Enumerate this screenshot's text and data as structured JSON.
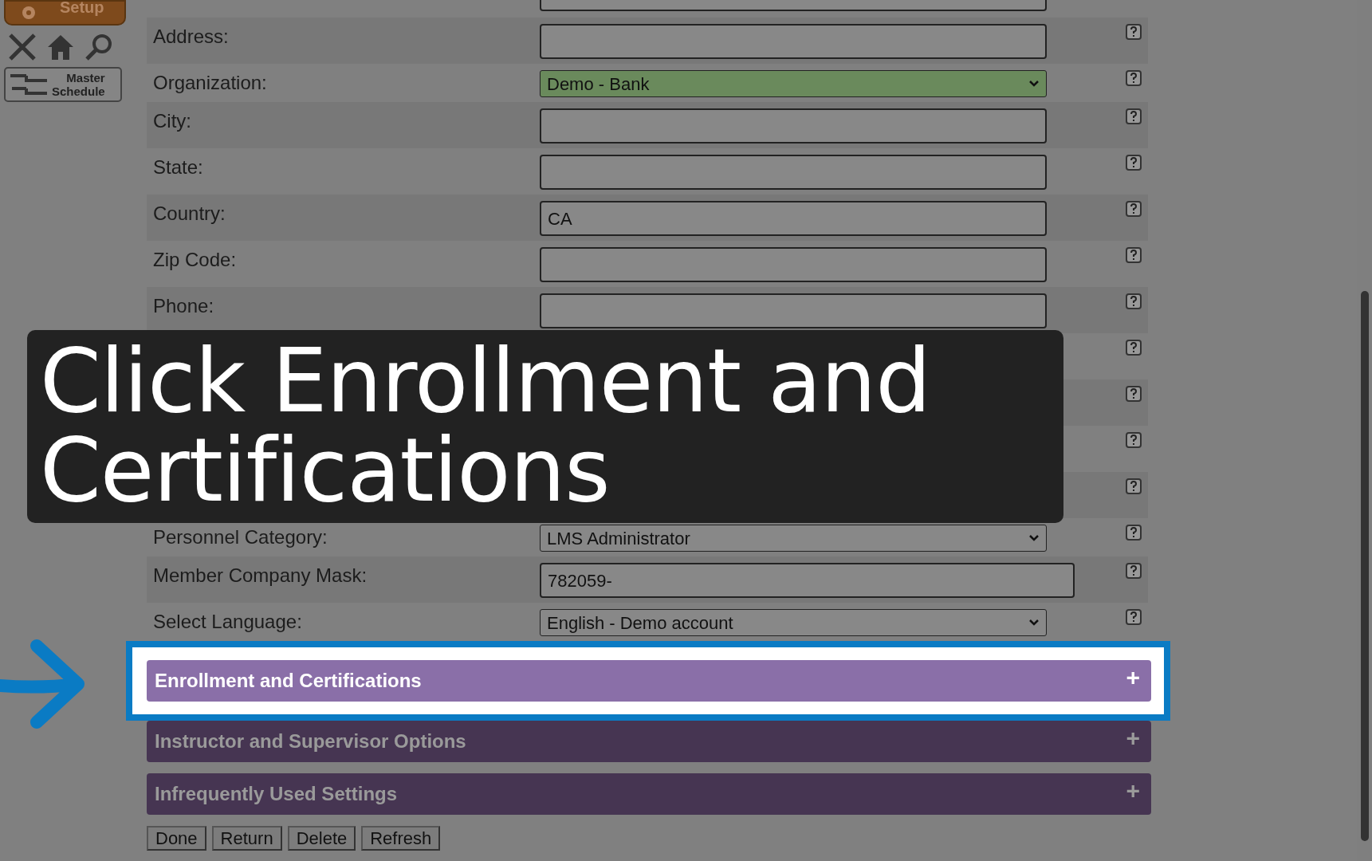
{
  "sidebar": {
    "setup_button": "Setup",
    "schedule_button": [
      "Master",
      "Schedule"
    ]
  },
  "form": {
    "rows": [
      {
        "kind": "input",
        "label": "Address:",
        "value": ""
      },
      {
        "kind": "select",
        "label": "Organization:",
        "value": "Demo - Bank",
        "highlighted": true
      },
      {
        "kind": "input",
        "label": "City:",
        "value": ""
      },
      {
        "kind": "input",
        "label": "State:",
        "value": ""
      },
      {
        "kind": "input",
        "label": "Country:",
        "value": "CA"
      },
      {
        "kind": "input",
        "label": "Zip Code:",
        "value": ""
      },
      {
        "kind": "input",
        "label": "Phone:",
        "value": ""
      },
      {
        "kind": "covered"
      },
      {
        "kind": "covered"
      },
      {
        "kind": "covered"
      },
      {
        "kind": "covered"
      },
      {
        "kind": "select",
        "label": "Personnel Category:",
        "value": "LMS Administrator",
        "highlighted": false
      },
      {
        "kind": "wide",
        "label": "Member Company Mask:",
        "value": "782059-"
      },
      {
        "kind": "select",
        "label": "Select Language:",
        "value": "English - Demo account",
        "highlighted": false
      }
    ]
  },
  "sections": [
    {
      "title": "Enrollment and Certifications",
      "toggle": "+",
      "highlighted": true
    },
    {
      "title": "Instructor and Supervisor Options",
      "toggle": "+",
      "highlighted": false
    },
    {
      "title": "Infrequently Used Settings",
      "toggle": "+",
      "highlighted": false
    }
  ],
  "buttons": [
    "Done",
    "Return",
    "Delete",
    "Refresh"
  ],
  "caption": "Click Enrollment and Certifications"
}
